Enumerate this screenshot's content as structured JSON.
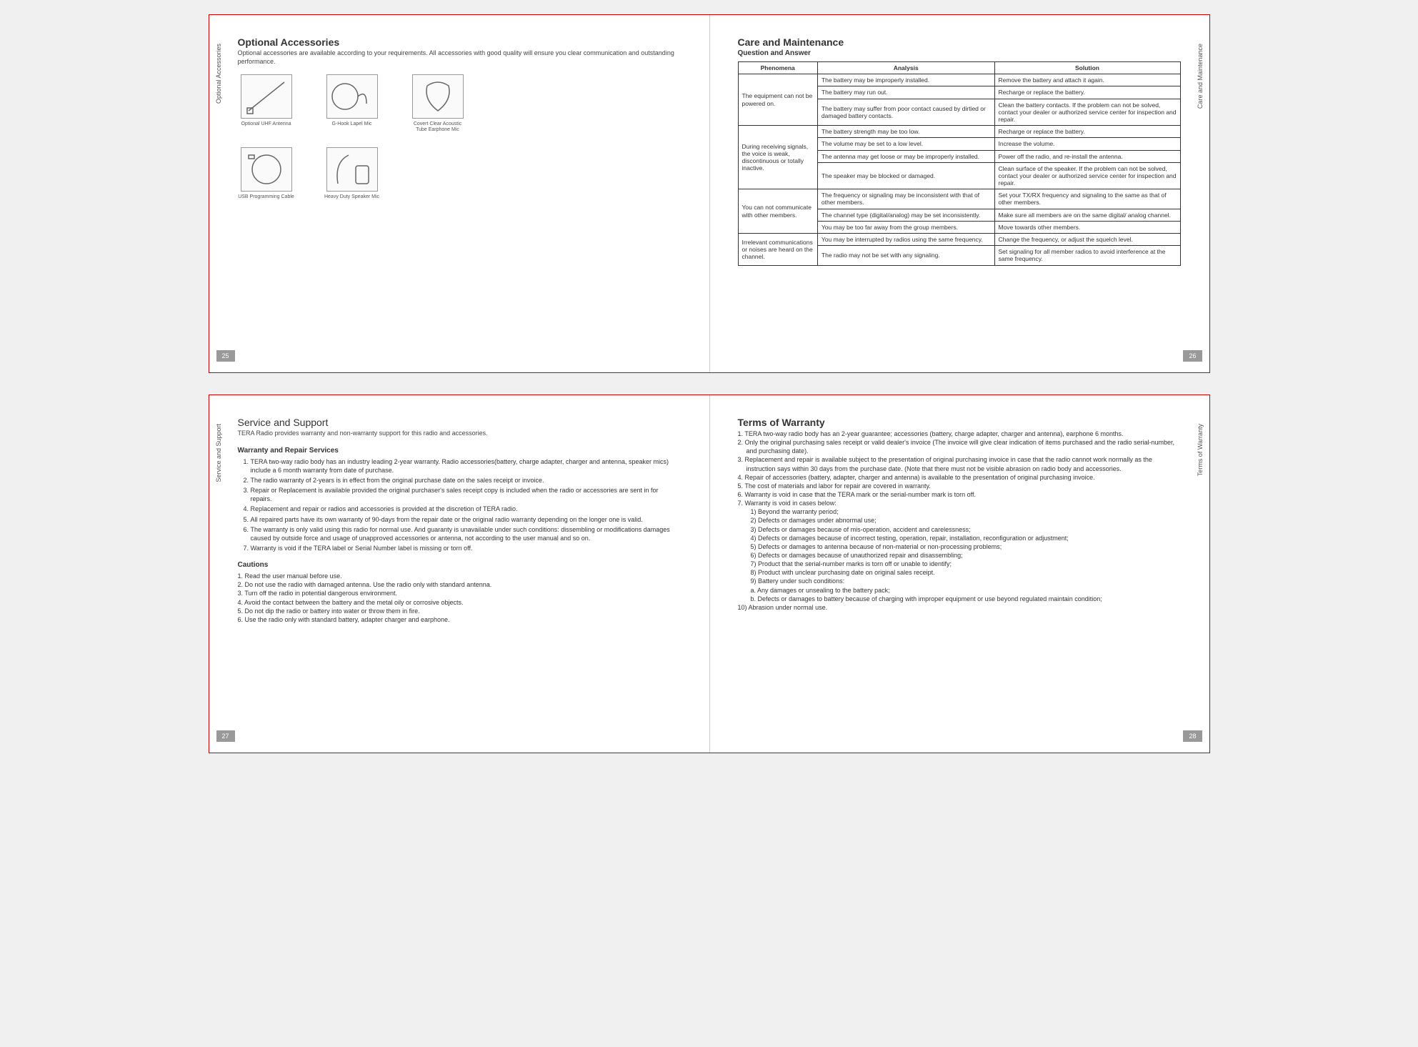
{
  "spread1": {
    "left": {
      "sidetab": "Optional Accessories",
      "pagenum": "25",
      "title": "Optional Accessories",
      "intro": "Optional accessories are available according to your requirements. All accessories with good quality will ensure you clear communication and outstanding performance.",
      "items": [
        {
          "label": "Optional UHF Antenna"
        },
        {
          "label": "G-Hook Lapel Mic"
        },
        {
          "label": "Covert Clear Acoustic Tube Earphone Mic"
        },
        {
          "label": "USB Programming Cable"
        },
        {
          "label": "Heavy Duty Speaker Mic"
        }
      ]
    },
    "right": {
      "sidetab": "Care and Maintenance",
      "pagenum": "26",
      "title": "Care and Maintenance",
      "subtitle": "Question and Answer",
      "headers": {
        "ph": "Phenomena",
        "an": "Analysis",
        "so": "Solution"
      },
      "rows": [
        {
          "ph": "The equipment can not be powered on.",
          "phrs": 3,
          "an": "The battery may be improperly installed.",
          "so": "Remove the battery and attach it again."
        },
        {
          "an": "The battery may run out.",
          "so": "Recharge or replace the battery."
        },
        {
          "an": "The battery may suffer from poor contact caused by dirtied or damaged battery contacts.",
          "so": "Clean the battery contacts. If the problem can not be solved, contact your dealer or authorized service center for inspection and repair."
        },
        {
          "ph": "During receiving signals, the voice is weak, discontinuous or totally inactive.",
          "phrs": 4,
          "an": "The battery strength may be too low.",
          "so": "Recharge or replace the battery."
        },
        {
          "an": "The volume may be set to a low level.",
          "so": "Increase the volume."
        },
        {
          "an": "The antenna may get loose or may be improperly installed.",
          "so": "Power off the radio, and re-install the antenna."
        },
        {
          "an": "The speaker may be blocked or damaged.",
          "so": "Clean surface of the speaker. If the problem can not be solved, contact your dealer or authorized service center for inspection and repair."
        },
        {
          "ph": "You can not communicate with other members.",
          "phrs": 3,
          "an": "The frequency or signaling may be inconsistent with that of other members.",
          "so": "Set your TX/RX frequency and signaling to the same as that of other members."
        },
        {
          "an": "The channel type (digital/analog) may be set inconsistently.",
          "so": "Make sure all members are on the same digital/ analog channel."
        },
        {
          "an": "You may be too far away from the group members.",
          "so": "Move towards other members."
        },
        {
          "ph": "Irrelevant communications or noises are heard on the channel.",
          "phrs": 2,
          "an": "You may be interrupted by radios using the same frequency.",
          "so": "Change the frequency, or adjust the squelch level."
        },
        {
          "an": "The radio may not be set with any signaling.",
          "so": "Set signaling for all member radios to avoid interference at the same frequency."
        }
      ]
    }
  },
  "spread2": {
    "left": {
      "sidetab": "Service and Support",
      "pagenum": "27",
      "title": "Service and Support",
      "intro": "TERA Radio provides warranty and non-warranty support for this radio and accessories.",
      "h3a": "Warranty and Repair Services",
      "list1": [
        "TERA two-way radio body has an industry leading 2-year warranty. Radio accessories(battery, charge adapter, charger and antenna, speaker mics) include a 6 month warranty from date of purchase.",
        "The radio warranty of 2-years is in effect from the original purchase date on the sales receipt or invoice.",
        "Repair or Replacement is available provided the original purchaser's sales receipt copy is included when the radio or accessories are sent in for repairs.",
        "Replacement and repair or radios and accessories is provided at the discretion of TERA radio.",
        "All repaired parts have its own warranty of 90-days from the repair date or the original radio warranty depending on the longer  one is valid.",
        "The warranty is only valid using this radio for normal use. And guaranty is unavailable under such conditions: dissembling or modifications damages caused by outside force and usage of unapproved accessories or antenna, not according to the user manual and so on.",
        "Warranty is void if the TERA label or Serial Number label is missing or torn off."
      ],
      "h3b": "Cautions",
      "list2": [
        "Read the user manual before use.",
        "Do not use the radio with damaged antenna. Use the radio only with standard antenna.",
        "Turn off the radio in potential dangerous environment.",
        "Avoid the contact between the battery and the metal oily or corrosive objects.",
        "Do not dip the radio or battery into water or throw them in fire.",
        "Use the radio only with standard battery, adapter charger and earphone."
      ]
    },
    "right": {
      "sidetab": "Terms of Warranty",
      "pagenum": "28",
      "title": "Terms of Warranty",
      "list": [
        "TERA two-way radio body has an 2-year guarantee; accessories (battery, charge adapter, charger and antenna), earphone 6 months.",
        "Only the original purchasing sales receipt or valid dealer's invoice (The invoice will give clear indication of items purchased and the radio serial-number, and purchasing date).",
        "Replacement and repair is available subject to the presentation of original purchasing invoice in case that the radio cannot work normally as the instruction says within 30 days from the purchase date. (Note that there must not be visible abrasion on radio body and accessories.",
        "Repair of accessories (battery, adapter, charger and antenna) is available to the presentation of original purchasing invoice.",
        "The cost of materials and labor for repair are covered in warranty.",
        "Warranty is void in case that the TERA mark or the serial-number mark is torn off.",
        "Warranty is void in cases below:"
      ],
      "sub7": [
        "1) Beyond the warranty period;",
        "2) Defects or damages under abnormal use;",
        "3) Defects or damages because of mis-operation, accident and carelessness;",
        "4) Defects or damages because of incorrect testing, operation, repair, installation, reconfiguration or adjustment;",
        "5) Defects or damages to antenna because of non-material or non-processing problems;",
        "6) Defects or damages because of unauthorized repair and disassembling;",
        "7) Product that the serial-number marks is torn off or unable to identify;",
        "8) Product with unclear purchasing date on original sales receipt.",
        "9) Battery under such conditions:",
        " a. Any damages or unsealing to the battery pack;",
        " b. Defects or damages to battery because of charging with improper equipment or use beyond regulated maintain condition;"
      ],
      "item10": "10) Abrasion under normal use."
    }
  }
}
